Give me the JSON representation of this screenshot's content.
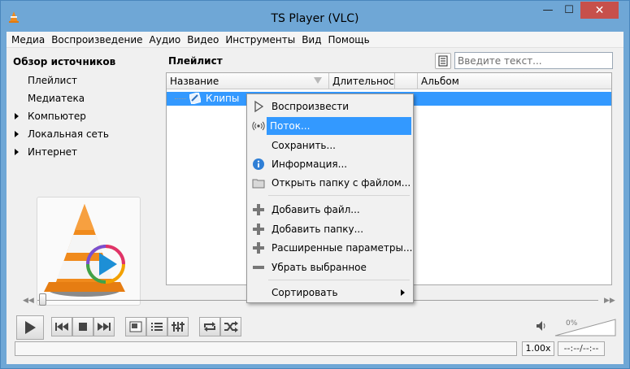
{
  "window": {
    "title": "TS Player (VLC)",
    "controls": {
      "minimize": "—",
      "maximize": "☐",
      "close": "✕"
    }
  },
  "menubar": [
    "Медиа",
    "Воспроизведение",
    "Аудио",
    "Видео",
    "Инструменты",
    "Вид",
    "Помощь"
  ],
  "sidebar": {
    "heading": "Обзор источников",
    "items": [
      {
        "label": "Плейлист",
        "expandable": false
      },
      {
        "label": "Медиатека",
        "expandable": false
      },
      {
        "label": "Компьютер",
        "expandable": true
      },
      {
        "label": "Локальная сеть",
        "expandable": true
      },
      {
        "label": "Интернет",
        "expandable": true
      }
    ]
  },
  "playlist": {
    "title": "Плейлист",
    "search_placeholder": "Введите текст...",
    "columns": [
      "Название",
      "Длительност",
      "",
      "Альбом"
    ],
    "rows": [
      {
        "name": "Клипы",
        "selected": true
      }
    ]
  },
  "context_menu": {
    "items": [
      {
        "label": "Воспроизвести",
        "icon": "play-icon"
      },
      {
        "label": "Поток...",
        "icon": "stream-icon",
        "highlighted": true
      },
      {
        "label": "Сохранить...",
        "icon": ""
      },
      {
        "label": "Информация...",
        "icon": "info-icon"
      },
      {
        "label": "Открыть папку с файлом...",
        "icon": "folder-icon"
      },
      {
        "label": "Добавить файл...",
        "icon": "plus-icon"
      },
      {
        "label": "Добавить папку...",
        "icon": "plus-icon"
      },
      {
        "label": "Расширенные параметры...",
        "icon": "plus-icon"
      },
      {
        "label": "Убрать выбранное",
        "icon": "minus-icon"
      },
      {
        "label": "Сортировать",
        "icon": "",
        "submenu": true
      }
    ]
  },
  "controls": {
    "volume": "0%"
  },
  "status": {
    "rate": "1.00x",
    "time": "--:--/--:--"
  },
  "colors": {
    "accent": "#3399ff",
    "titlebar": "#6fa7d6",
    "close": "#c7504b"
  }
}
